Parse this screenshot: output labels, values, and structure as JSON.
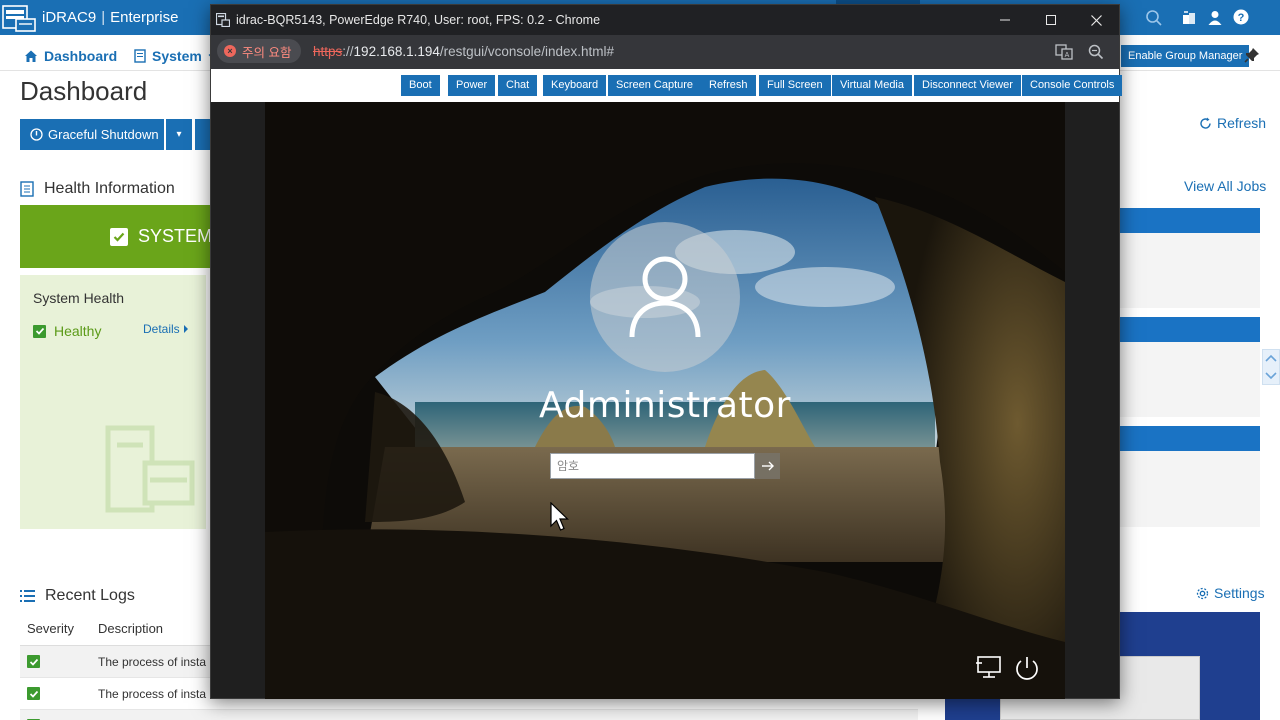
{
  "app": {
    "brand": "iDRAC9",
    "edition": "Enterprise"
  },
  "nav": {
    "dashboard": "Dashboard",
    "system": "System",
    "group_manager_button": "Enable Group Manager"
  },
  "page": {
    "title": "Dashboard",
    "graceful_shutdown": "Graceful Shutdown",
    "health_title": "Health Information",
    "health_banner": "SYSTEM",
    "system_health_label": "System Health",
    "system_health_status": "Healthy",
    "details_link": "Details",
    "refresh_link": "Refresh",
    "view_all_jobs": "View All Jobs",
    "settings_link": "Settings"
  },
  "logs": {
    "title": "Recent Logs",
    "columns": [
      "Severity",
      "Description"
    ],
    "rows": [
      {
        "severity": "ok",
        "description": "The process of insta"
      },
      {
        "severity": "ok",
        "description": "The process of insta"
      }
    ]
  },
  "chrome": {
    "window_title": "idrac-BQR5143, PowerEdge R740, User: root, FPS: 0.2 - Chrome",
    "security_chip": "주의 요함",
    "url_scheme": "https",
    "url_host": "192.168.1.194",
    "url_path": "/restgui/vconsole/index.html#"
  },
  "toolbar": {
    "buttons": [
      "Boot",
      "Power",
      "Chat",
      "Keyboard",
      "Screen Capture",
      "Refresh",
      "Full Screen",
      "Virtual Media",
      "Disconnect Viewer",
      "Console Controls"
    ]
  },
  "console": {
    "username": "Administrator",
    "password_placeholder": "암호"
  },
  "colors": {
    "idrac_blue": "#1a6fb4",
    "health_green": "#6aa51a",
    "chrome_dark": "#202124",
    "warning_red": "#ee675c"
  }
}
